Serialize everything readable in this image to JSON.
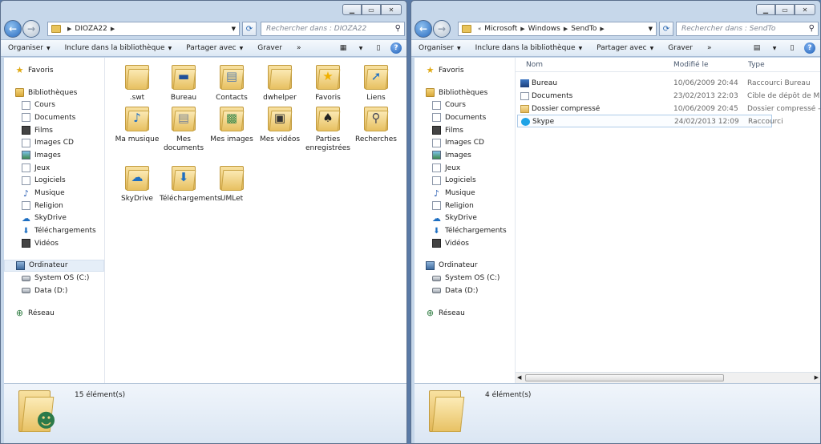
{
  "left": {
    "address": {
      "crumbs": [
        "DIOZA22"
      ]
    },
    "search_placeholder": "Rechercher dans : DIOZA22",
    "toolbar": {
      "organize": "Organiser",
      "include": "Inclure dans la bibliothèque",
      "share": "Partager avec",
      "burn": "Graver",
      "more": "»"
    },
    "nav": {
      "favorites": "Favoris",
      "libraries": "Bibliothèques",
      "library_items": [
        "Cours",
        "Documents",
        "Films",
        "Images CD",
        "Images",
        "Jeux",
        "Logiciels",
        "Musique",
        "Religion",
        "SkyDrive",
        "Téléchargements",
        "Vidéos"
      ],
      "computer": "Ordinateur",
      "drives": [
        "System OS (C:)",
        "Data (D:)"
      ],
      "network": "Réseau"
    },
    "items": [
      {
        "label": ".swt",
        "icon": "folder-icon"
      },
      {
        "label": "Bureau",
        "icon": "desktop-folder-icon"
      },
      {
        "label": "Contacts",
        "icon": "contacts-folder-icon"
      },
      {
        "label": "dwhelper",
        "icon": "folder-icon"
      },
      {
        "label": "Favoris",
        "icon": "favorites-folder-icon"
      },
      {
        "label": "Liens",
        "icon": "links-folder-icon"
      },
      {
        "label": "Ma musique",
        "icon": "music-folder-icon"
      },
      {
        "label": "Mes documents",
        "icon": "documents-folder-icon"
      },
      {
        "label": "Mes images",
        "icon": "pictures-folder-icon"
      },
      {
        "label": "Mes vidéos",
        "icon": "videos-folder-icon"
      },
      {
        "label": "Parties enregistrées",
        "icon": "saved-games-folder-icon"
      },
      {
        "label": "Recherches",
        "icon": "searches-folder-icon"
      },
      {
        "label": "SkyDrive",
        "icon": "skydrive-folder-icon"
      },
      {
        "label": "Téléchargements",
        "icon": "downloads-folder-icon"
      },
      {
        "label": "UMLet",
        "icon": "folder-icon"
      }
    ],
    "status": "15 élément(s)"
  },
  "right": {
    "address": {
      "prefix": "«",
      "crumbs": [
        "Microsoft",
        "Windows",
        "SendTo"
      ]
    },
    "search_placeholder": "Rechercher dans : SendTo",
    "toolbar": {
      "organize": "Organiser",
      "include": "Inclure dans la bibliothèque",
      "share": "Partager avec",
      "burn": "Graver",
      "more": "»"
    },
    "nav": {
      "favorites": "Favoris",
      "libraries": "Bibliothèques",
      "library_items": [
        "Cours",
        "Documents",
        "Films",
        "Images CD",
        "Images",
        "Jeux",
        "Logiciels",
        "Musique",
        "Religion",
        "SkyDrive",
        "Téléchargements",
        "Vidéos"
      ],
      "computer": "Ordinateur",
      "drives": [
        "System OS (C:)",
        "Data (D:)"
      ],
      "network": "Réseau"
    },
    "columns": {
      "name": "Nom",
      "modified": "Modifié le",
      "type": "Type"
    },
    "rows": [
      {
        "name": "Bureau",
        "modified": "10/06/2009 20:44",
        "type": "Raccourci Bureau",
        "icon": "desktop-icon"
      },
      {
        "name": "Documents",
        "modified": "23/02/2013 22:03",
        "type": "Cible de dépôt de M",
        "icon": "documents-icon"
      },
      {
        "name": "Dossier compressé",
        "modified": "10/06/2009 20:45",
        "type": "Dossier compressé -",
        "icon": "zip-folder-icon"
      },
      {
        "name": "Skype",
        "modified": "24/02/2013 12:09",
        "type": "Raccourci",
        "icon": "skype-icon"
      }
    ],
    "status": "4 élément(s)"
  },
  "colors": {
    "chrome": "#c6d7ea",
    "toolbar": "#dce8f4",
    "folder": "#e7c061",
    "selection": "#e5eef8"
  }
}
